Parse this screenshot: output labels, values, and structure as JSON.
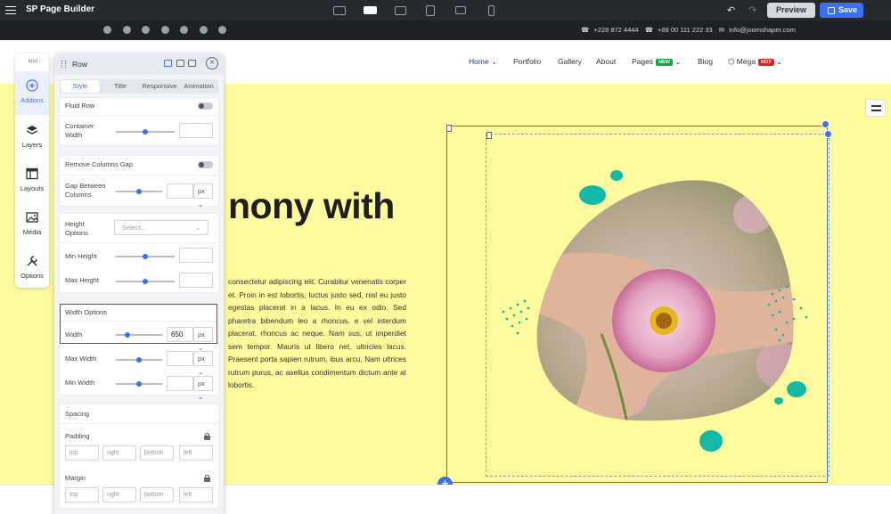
{
  "app": {
    "title": "SP Page Builder"
  },
  "toolbar": {
    "devices": [
      "desktop-icon",
      "laptop-icon",
      "tablet-landscape-icon",
      "tablet-icon",
      "tablet-wide-icon",
      "mobile-icon"
    ],
    "active_device": 1,
    "preview_label": "Preview",
    "save_label": "Save"
  },
  "topstrip": {
    "socials": [
      "facebook-icon",
      "twitter-icon",
      "pinterest-icon",
      "youtube-icon",
      "linkedin-icon",
      "instagram-icon",
      "flickr-icon"
    ],
    "phone1": "+228 872 4444",
    "phone2": "+88 00 111 222 33",
    "email": "info@joomshaper.com"
  },
  "nav": {
    "items": [
      "Home",
      "Portfolio",
      "Gallery",
      "About",
      "Pages",
      "Blog",
      "Mega"
    ],
    "pages_badge": "NEW",
    "mega_badge": "HOT"
  },
  "hero": {
    "heading": "nony with",
    "paragraph": "consectetur adipiscing elit. Curabitur venenatis corper et. Proin in est lobortis, luctus justo sed, nisl eu justo egestas placerat in a lacus. In eu ex odio. Sed pharetra bibendum leo a rhoncus. e vel interdum placerat, rhoncus ac neque. Nam sus, ut imperdiet sem tempor. Mauris ut libero net, ultricies lacus. Praesent porta sapien rutrum, ibus arcu. Nam ultrices rutrum purus, ac asellus condimentum dictum ante at lobortis."
  },
  "sidebar": {
    "items": [
      {
        "label": "Addons",
        "icon": "plus-circle-icon"
      },
      {
        "label": "Layers",
        "icon": "layers-icon"
      },
      {
        "label": "Layouts",
        "icon": "layouts-icon"
      },
      {
        "label": "Media",
        "icon": "media-icon"
      },
      {
        "label": "Options",
        "icon": "tools-icon"
      }
    ]
  },
  "panel": {
    "title": "Row",
    "tabs": [
      "Style",
      "Title",
      "Responsive",
      "Animation"
    ],
    "fluid_row": "Fluid Row",
    "container_width": "Container Width",
    "remove_gap": "Remove Columns Gap",
    "gap_between": "Gap Between Columns",
    "height_options": "Height Options",
    "select_placeholder": "Select...",
    "min_height": "Min Height",
    "max_height": "Max Height",
    "width_options": "Width Options",
    "width": "Width",
    "width_value": "650",
    "unit": "px",
    "max_width": "Max Width",
    "min_width": "Min Width",
    "spacing": "Spacing",
    "padding": "Padding",
    "margin": "Margin",
    "sides": [
      "top",
      "right",
      "bottom",
      "left"
    ]
  },
  "colors": {
    "accent": "#3b6ff4",
    "hero_bg": "#fdfb9e",
    "highlight": "#e02020",
    "teal": "#14b8a6",
    "new_badge": "#16a34a",
    "hot_badge": "#dc2626"
  }
}
